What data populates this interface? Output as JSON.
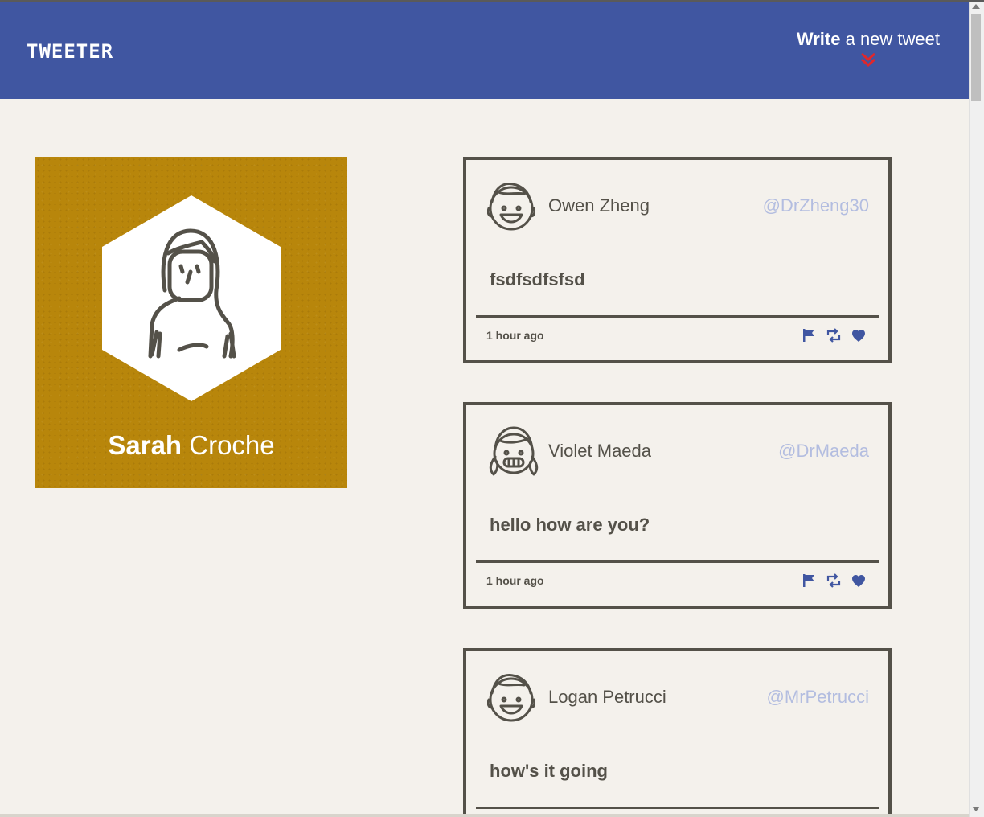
{
  "header": {
    "brand": "TWEETER",
    "compose_bold": "Write",
    "compose_rest": " a new tweet"
  },
  "profile": {
    "first_name": "Sarah",
    "last_name": "Croche"
  },
  "colors": {
    "nav": "#4056a1",
    "profile_bg": "#b8860b",
    "accent_red": "#e0272b",
    "handle": "#b3bde0",
    "text": "#545149"
  },
  "tweets": [
    {
      "name": "Owen Zheng",
      "handle": "@DrZheng30",
      "body": "fsdfsdfsfsd",
      "time": "1 hour ago",
      "avatar": "boy-avatar-icon"
    },
    {
      "name": "Violet Maeda",
      "handle": "@DrMaeda",
      "body": "hello how are you?",
      "time": "1 hour ago",
      "avatar": "girl-avatar-icon"
    },
    {
      "name": "Logan Petrucci",
      "handle": "@MrPetrucci",
      "body": "how's it going",
      "time": "",
      "avatar": "boy-avatar-icon"
    }
  ],
  "actions": [
    "flag-icon",
    "retweet-icon",
    "heart-icon"
  ]
}
